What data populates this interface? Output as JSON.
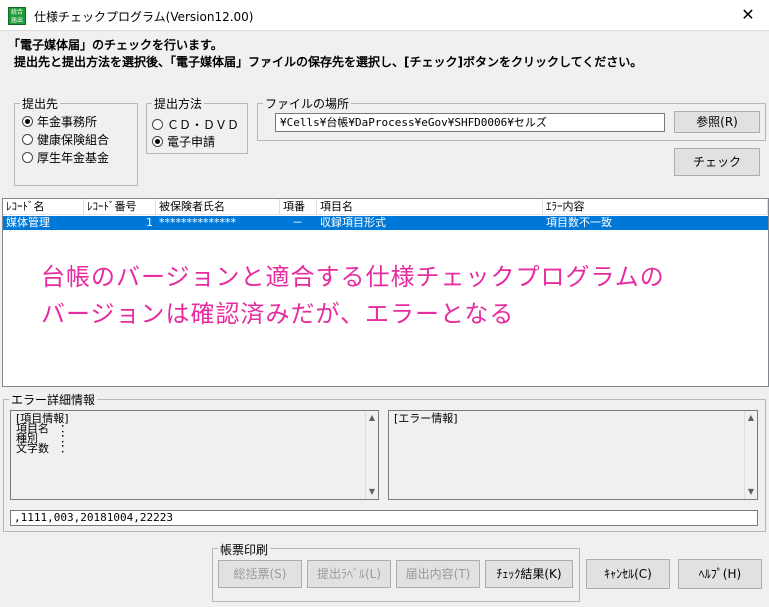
{
  "window": {
    "icon_text": "統合届出",
    "title": "仕様チェックプログラム(Version12.00)",
    "close_glyph": "✕"
  },
  "intro": {
    "line1": "「電子媒体届」のチェックを行います。",
    "line2": "提出先と提出方法を選択後、「電子媒体届」ファイルの保存先を選択し、[チェック]ボタンをクリックしてください。"
  },
  "submit_to": {
    "label": "提出先",
    "options": [
      {
        "label": "年金事務所",
        "selected": true
      },
      {
        "label": "健康保険組合",
        "selected": false
      },
      {
        "label": "厚生年金基金",
        "selected": false
      }
    ]
  },
  "submit_method": {
    "label": "提出方法",
    "options": [
      {
        "label": "ＣＤ・ＤＶＤ",
        "selected": false
      },
      {
        "label": "電子申請",
        "selected": true
      }
    ]
  },
  "file_location": {
    "label": "ファイルの場所",
    "path": "¥Cells¥台帳¥DaProcess¥eGov¥SHFD0006¥セルズ",
    "browse_label": "参照(R)"
  },
  "check_label": "チェック",
  "list": {
    "columns": [
      "ﾚｺｰﾄﾞ名",
      "ﾚｺｰﾄﾞ番号",
      "被保険者氏名",
      "項番",
      "項目名",
      "ｴﾗｰ内容"
    ],
    "rows": [
      [
        "媒体管理",
        "1",
        "**************",
        "－",
        "収録項目形式",
        "項目数不一致"
      ]
    ]
  },
  "annotation": {
    "line1": "台帳のバージョンと適合する仕様チェックプログラムの",
    "line2": "バージョンは確認済みだが、エラーとなる"
  },
  "error_details": {
    "label": "エラー詳細情報",
    "item_info": {
      "heading": "[項目情報]",
      "lines": [
        "項目名　：",
        "種別　　：",
        "文字数　："
      ]
    },
    "error_info": {
      "heading": "[エラー情報]"
    },
    "raw_record": ",1111,003,20181004,22223"
  },
  "print": {
    "label": "帳票印刷",
    "buttons": [
      "総括票(S)",
      "提出ﾗﾍﾞﾙ(L)",
      "届出内容(T)",
      "ﾁｪｯｸ結果(K)"
    ],
    "disabled": [
      true,
      true,
      true,
      false
    ]
  },
  "cancel_label": "ｷｬﾝｾﾙ(C)",
  "help_label": "ﾍﾙﾌﾟ(H)",
  "colors": {
    "selection": "#0078d7",
    "annotation": "#e62ca0",
    "app_icon": "#1e9c3a"
  }
}
